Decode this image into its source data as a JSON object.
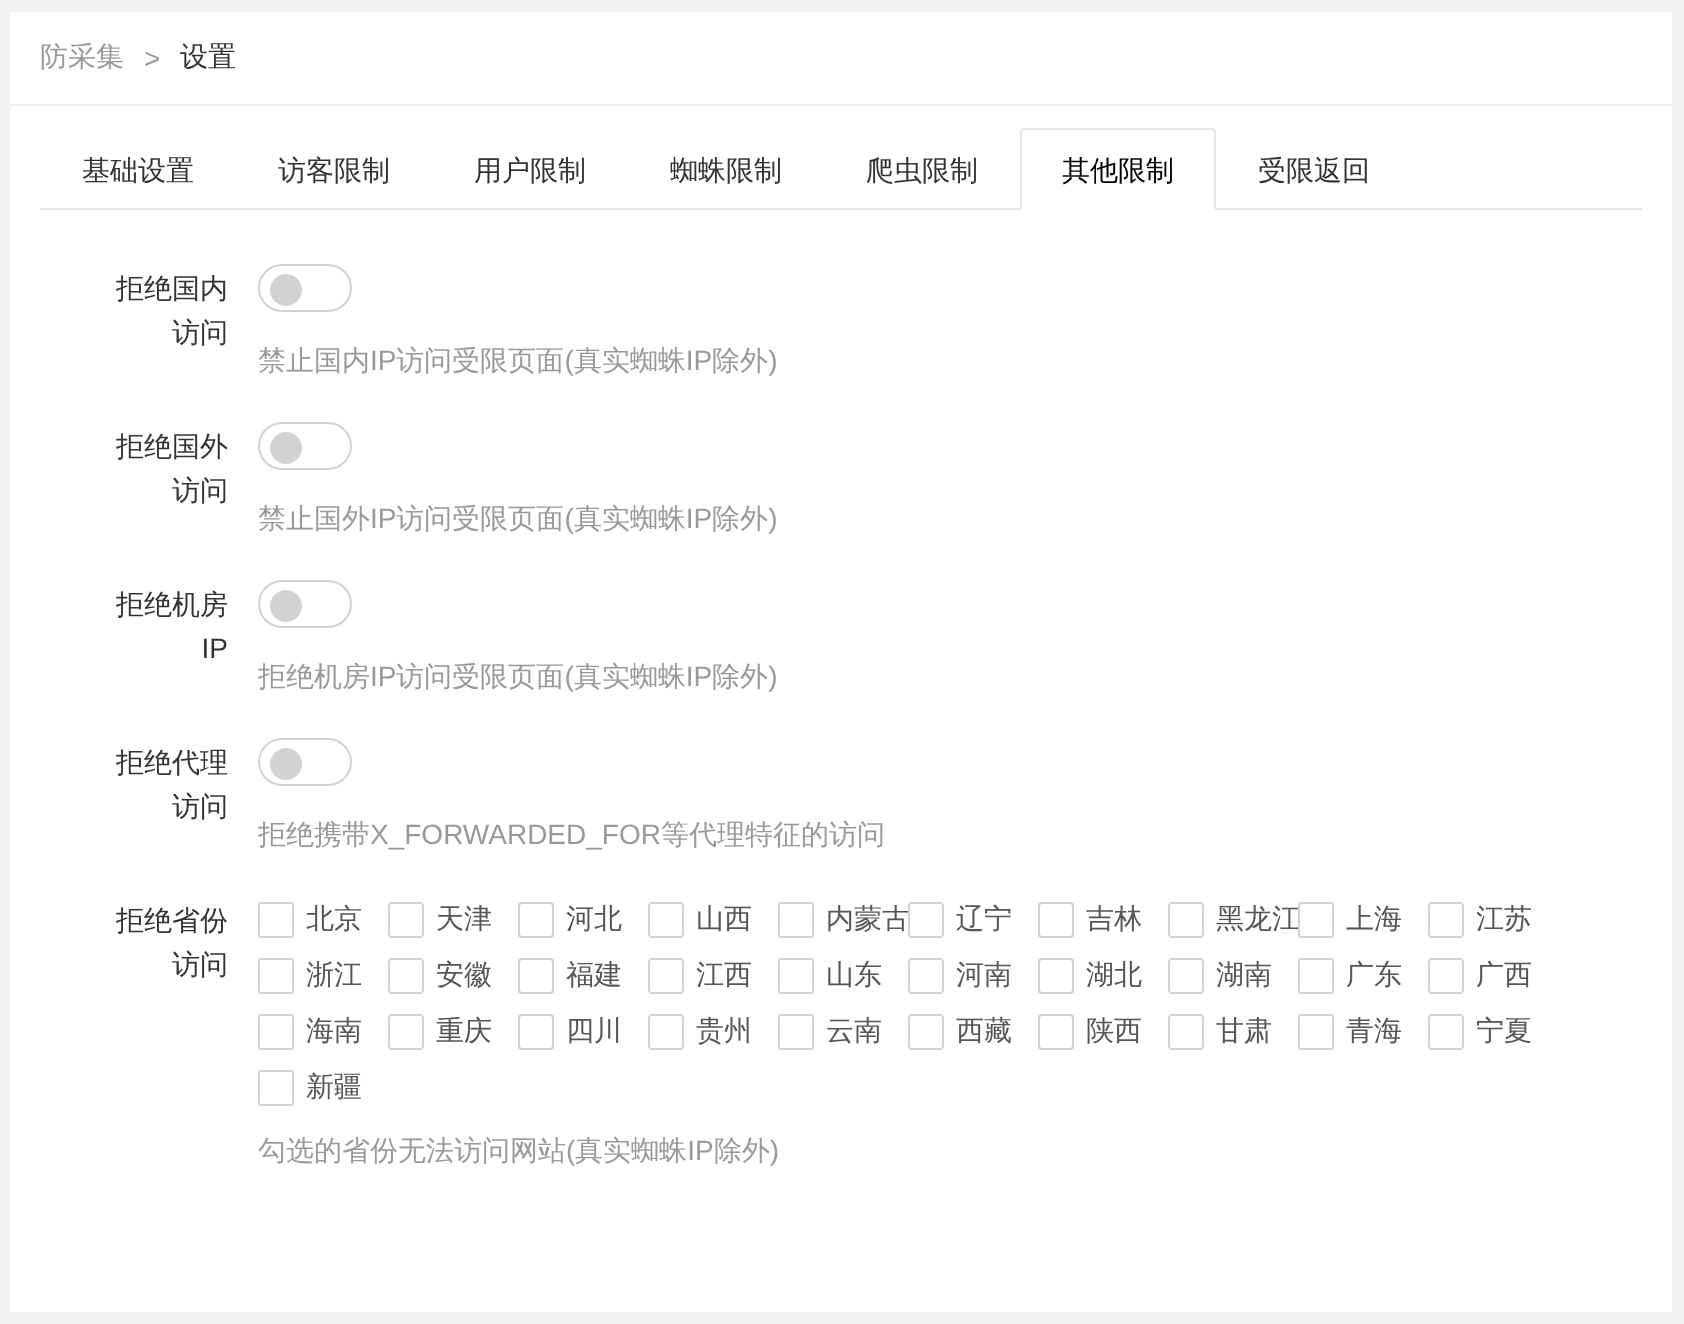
{
  "breadcrumb": {
    "items": [
      "防采集",
      "设置"
    ],
    "separator": ">"
  },
  "tabs": [
    {
      "label": "基础设置",
      "selected": false
    },
    {
      "label": "访客限制",
      "selected": false
    },
    {
      "label": "用户限制",
      "selected": false
    },
    {
      "label": "蜘蛛限制",
      "selected": false
    },
    {
      "label": "爬虫限制",
      "selected": false
    },
    {
      "label": "其他限制",
      "selected": true
    },
    {
      "label": "受限返回",
      "selected": false
    }
  ],
  "settings": [
    {
      "kind": "switch",
      "label": "拒绝国内访问",
      "on": false,
      "help": "禁止国内IP访问受限页面(真实蜘蛛IP除外)"
    },
    {
      "kind": "switch",
      "label": "拒绝国外访问",
      "on": false,
      "help": "禁止国外IP访问受限页面(真实蜘蛛IP除外)"
    },
    {
      "kind": "switch",
      "label": "拒绝机房IP",
      "on": false,
      "help": "拒绝机房IP访问受限页面(真实蜘蛛IP除外)"
    },
    {
      "kind": "switch",
      "label": "拒绝代理访问",
      "on": false,
      "help": "拒绝携带X_FORWARDED_FOR等代理特征的访问"
    },
    {
      "kind": "checkboxes",
      "label": "拒绝省份访问",
      "help": "勾选的省份无法访问网站(真实蜘蛛IP除外)",
      "options": [
        {
          "label": "北京",
          "checked": false
        },
        {
          "label": "天津",
          "checked": false
        },
        {
          "label": "河北",
          "checked": false
        },
        {
          "label": "山西",
          "checked": false
        },
        {
          "label": "内蒙古",
          "checked": false
        },
        {
          "label": "辽宁",
          "checked": false
        },
        {
          "label": "吉林",
          "checked": false
        },
        {
          "label": "黑龙江",
          "checked": false
        },
        {
          "label": "上海",
          "checked": false
        },
        {
          "label": "江苏",
          "checked": false
        },
        {
          "label": "浙江",
          "checked": false
        },
        {
          "label": "安徽",
          "checked": false
        },
        {
          "label": "福建",
          "checked": false
        },
        {
          "label": "江西",
          "checked": false
        },
        {
          "label": "山东",
          "checked": false
        },
        {
          "label": "河南",
          "checked": false
        },
        {
          "label": "湖北",
          "checked": false
        },
        {
          "label": "湖南",
          "checked": false
        },
        {
          "label": "广东",
          "checked": false
        },
        {
          "label": "广西",
          "checked": false
        },
        {
          "label": "海南",
          "checked": false
        },
        {
          "label": "重庆",
          "checked": false
        },
        {
          "label": "四川",
          "checked": false
        },
        {
          "label": "贵州",
          "checked": false
        },
        {
          "label": "云南",
          "checked": false
        },
        {
          "label": "西藏",
          "checked": false
        },
        {
          "label": "陕西",
          "checked": false
        },
        {
          "label": "甘肃",
          "checked": false
        },
        {
          "label": "青海",
          "checked": false
        },
        {
          "label": "宁夏",
          "checked": false
        },
        {
          "label": "新疆",
          "checked": false
        }
      ]
    }
  ]
}
